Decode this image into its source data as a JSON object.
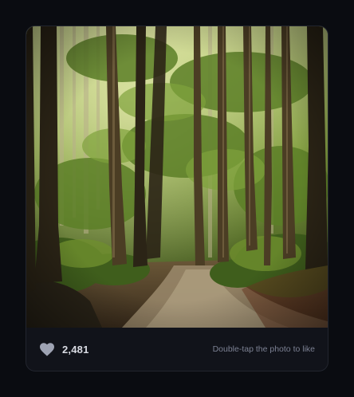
{
  "post": {
    "photo_alt": "forest-path-photo",
    "likes": "2,481",
    "hint": "Double-tap the photo to like",
    "liked": false
  },
  "icons": {
    "like": "heart-icon"
  },
  "colors": {
    "page_bg": "#0a0c11",
    "card_bg": "#11131a",
    "card_border": "#22252e",
    "heart": "#9ea3b3",
    "count_text": "#d9dbe3",
    "hint_text": "#7c8193"
  }
}
